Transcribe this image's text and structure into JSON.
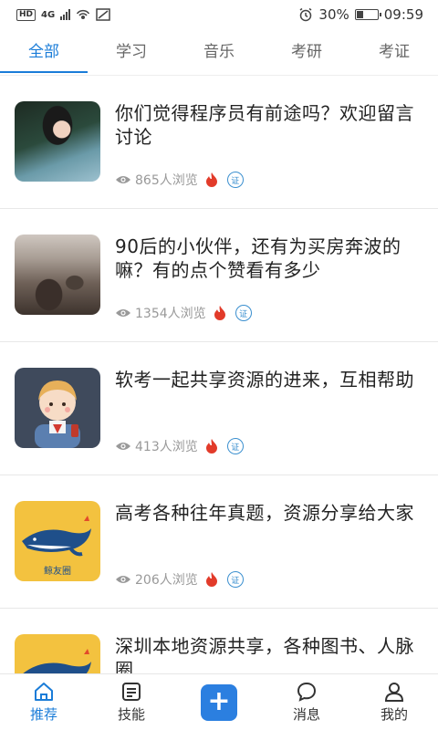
{
  "status_bar": {
    "hd": "HD",
    "network": "4G",
    "battery_text": "30%",
    "battery_level": 0.3,
    "time": "09:59"
  },
  "tabs": [
    {
      "label": "全部",
      "active": true
    },
    {
      "label": "学习",
      "active": false
    },
    {
      "label": "音乐",
      "active": false
    },
    {
      "label": "考研",
      "active": false
    },
    {
      "label": "考证",
      "active": false
    }
  ],
  "feed": [
    {
      "title": "你们觉得程序员有前途吗？欢迎留言讨论",
      "views": "865人浏览",
      "thumb": "girl-photo"
    },
    {
      "title": "90后的小伙伴，还有为买房奔波的嘛？有的点个赞看有多少",
      "views": "1354人浏览",
      "thumb": "beach-photo"
    },
    {
      "title": "软考一起共享资源的进来，互相帮助",
      "views": "413人浏览",
      "thumb": "cartoon-avatar"
    },
    {
      "title": "高考各种往年真题，资源分享给大家",
      "views": "206人浏览",
      "thumb": "whale-logo"
    },
    {
      "title": "深圳本地资源共享，各种图书、人脉圈",
      "views": "",
      "thumb": "whale-logo"
    }
  ],
  "badge_char": "证",
  "whale_logo_text": "鲸友圈",
  "bottom_nav": [
    {
      "label": "推荐",
      "icon": "home-icon",
      "active": true
    },
    {
      "label": "技能",
      "icon": "skills-icon",
      "active": false
    },
    {
      "label": "",
      "icon": "plus-icon",
      "active": false
    },
    {
      "label": "消息",
      "icon": "message-icon",
      "active": false
    },
    {
      "label": "我的",
      "icon": "profile-icon",
      "active": false
    }
  ],
  "colors": {
    "accent": "#1a7cd8",
    "fire": "#e23b2a",
    "badge": "#3a8fcf",
    "whale_bg": "#f3c23f"
  }
}
